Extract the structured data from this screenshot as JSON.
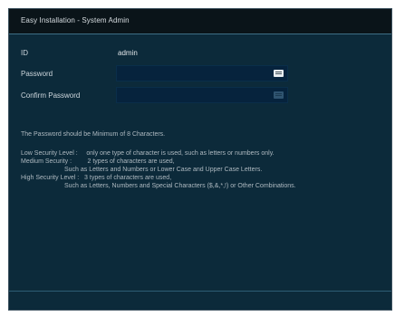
{
  "window": {
    "title": "Easy Installation - System Admin"
  },
  "form": {
    "id_label": "ID",
    "id_value": "admin",
    "password_label": "Password",
    "password_value": "",
    "confirm_label": "Confirm Password",
    "confirm_value": ""
  },
  "notes": {
    "min_chars": "The Password should be Minimum of 8 Characters.",
    "low_line": "Low Security Level :     only one type of character is used, such as letters or numbers only.",
    "medium_line1": "Medium Security :         2 types of characters are used,",
    "medium_line2": "Such as Letters and Numbers or Lower Case and Upper Case Letters.",
    "high_line1": "High Security Level :   3 types of characters are used,",
    "high_line2": "Such as Letters, Numbers and Special Characters ($,&,*,!) or Other Combinations."
  },
  "colors": {
    "window_bg": "#0c2a3a",
    "titlebar_bg": "#0a1419",
    "field_bg": "#06233d",
    "accent_line": "#3e6f86"
  },
  "icons": {
    "password_field": "keyboard-icon",
    "confirm_field": "keyboard-icon"
  }
}
